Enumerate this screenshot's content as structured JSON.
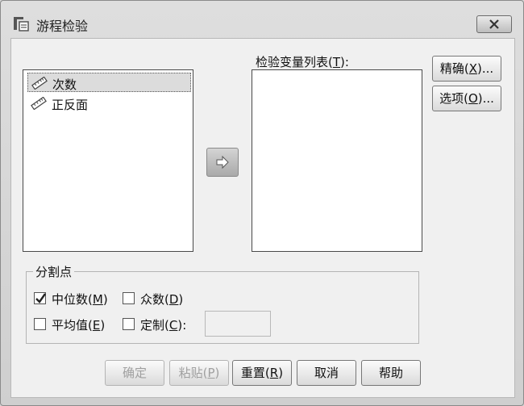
{
  "window": {
    "title": "游程检验",
    "close_icon": "close-x-icon"
  },
  "variable_list": {
    "items": [
      {
        "label": "次数",
        "icon": "scale-ruler-icon",
        "selected": true
      },
      {
        "label": "正反面",
        "icon": "scale-ruler-icon",
        "selected": false
      }
    ]
  },
  "move_button_icon": "arrow-right-icon",
  "test_list": {
    "label_pre": "检验变量列表(",
    "label_key": "T",
    "label_post": "):"
  },
  "side_buttons": {
    "exact": {
      "pre": "精确(",
      "key": "X",
      "post": ")..."
    },
    "options": {
      "pre": "选项(",
      "key": "O",
      "post": ")..."
    }
  },
  "cutpoint": {
    "legend": "分割点",
    "median": {
      "pre": "中位数(",
      "key": "M",
      "post": ")",
      "checked": true
    },
    "mode": {
      "pre": "众数(",
      "key": "D",
      "post": ")",
      "checked": false
    },
    "mean": {
      "pre": "平均值(",
      "key": "E",
      "post": ")",
      "checked": false
    },
    "custom": {
      "pre": "定制(",
      "key": "C",
      "post": "):",
      "checked": false
    },
    "custom_value": ""
  },
  "bottom_buttons": {
    "ok": {
      "label": "确定"
    },
    "paste": {
      "pre": "粘贴(",
      "key": "P",
      "post": ")"
    },
    "reset": {
      "pre": "重置(",
      "key": "R",
      "post": ")"
    },
    "cancel": {
      "label": "取消"
    },
    "help": {
      "label": "帮助"
    }
  }
}
